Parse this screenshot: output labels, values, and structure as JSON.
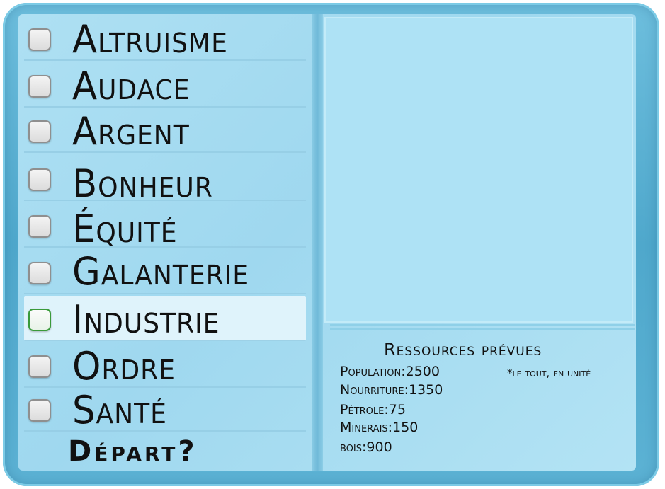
{
  "options": [
    {
      "label": "Altruisme",
      "selected": false
    },
    {
      "label": "Audace",
      "selected": false
    },
    {
      "label": "Argent",
      "selected": false
    },
    {
      "label": "Bonheur",
      "selected": false
    },
    {
      "label": "Équité",
      "selected": false
    },
    {
      "label": "Galanterie",
      "selected": false
    },
    {
      "label": "Industrie",
      "selected": true
    },
    {
      "label": "Ordre",
      "selected": false
    },
    {
      "label": "Santé",
      "selected": false
    }
  ],
  "start_label": "Départ?",
  "resources": {
    "title": "Ressources prévues",
    "note": "*le tout, en unité",
    "lines": [
      "Population:2500",
      "Nourriture:1350",
      "Pétrole:75",
      "Minerais:150",
      "bois:900"
    ]
  },
  "colors": {
    "frame": "#5cb2d4",
    "panel": "#aee0f3",
    "selected_row": "#dff3fb",
    "selected_checkbox_border": "#3a9a3a"
  }
}
